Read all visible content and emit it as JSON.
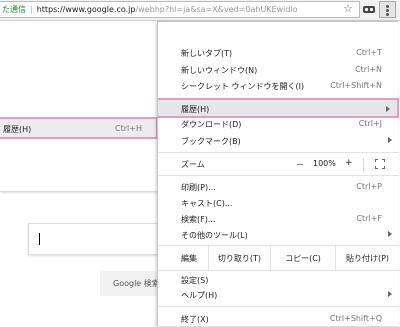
{
  "toolbar": {
    "secure_text": "た通信",
    "url_host": "https://www.google.co.jp",
    "url_rest": "/webhp?hl=ja&sa=X&ved=0ahUKEwidlo"
  },
  "submenu": {
    "label": "履歴(H)",
    "shortcut": "Ctrl+H"
  },
  "page": {
    "search_button": "Google 検索"
  },
  "menu": {
    "new_tab": {
      "label": "新しいタブ(T)",
      "shortcut": "Ctrl+T"
    },
    "new_window": {
      "label": "新しいウィンドウ(N)",
      "shortcut": "Ctrl+N"
    },
    "incognito": {
      "label": "シークレット ウィンドウを開く(I)",
      "shortcut": "Ctrl+Shift+N"
    },
    "history": {
      "label": "履歴(H)"
    },
    "downloads": {
      "label": "ダウンロード(D)",
      "shortcut": "Ctrl+J"
    },
    "bookmarks": {
      "label": "ブックマーク(B)"
    },
    "zoom": {
      "label": "ズーム",
      "minus": "－",
      "value": "100%",
      "plus": "+"
    },
    "print": {
      "label": "印刷(P)...",
      "shortcut": "Ctrl+P"
    },
    "cast": {
      "label": "キャスト(C)..."
    },
    "find": {
      "label": "検索(F)...",
      "shortcut": "Ctrl+F"
    },
    "more_tools": {
      "label": "その他のツール(L)"
    },
    "edit": {
      "label": "編集",
      "cut": "切り取り(T)",
      "copy": "コピー(C)",
      "paste": "貼り付け(P)"
    },
    "settings": {
      "label": "設定(S)"
    },
    "help": {
      "label": "ヘルプ(H)"
    },
    "exit": {
      "label": "終了(X)",
      "shortcut": "Ctrl+Shift+Q"
    }
  },
  "colors": {
    "highlight_border": "#ea9cc0",
    "secure_green": "#1a8a34"
  },
  "icons": [
    "star-icon",
    "extension-icon",
    "more-vert-icon",
    "fullscreen-icon",
    "chevron-right-icon"
  ]
}
